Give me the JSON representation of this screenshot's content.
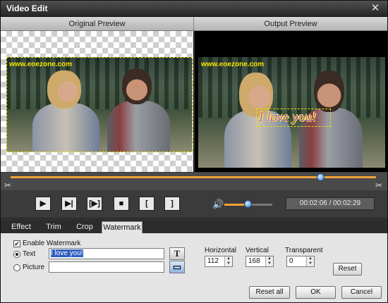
{
  "window": {
    "title": "Video Edit",
    "close_label": "✕"
  },
  "preview": {
    "original_label": "Original Preview",
    "output_label": "Output Preview",
    "site_text": "www.eoezone.com",
    "watermark_text": "I love you!"
  },
  "playback": {
    "time_display": "00:02:06 / 00:02:29",
    "position_fraction": 0.85,
    "volume_fraction": 0.5,
    "buttons": {
      "play": "▶",
      "step": "▶|",
      "frame": "[▶]",
      "stop": "■",
      "mark_in": "[",
      "mark_out": "]"
    }
  },
  "tabs": [
    {
      "label": "Effect"
    },
    {
      "label": "Trim"
    },
    {
      "label": "Crop"
    },
    {
      "label": "Watermark",
      "active": true
    }
  ],
  "watermark": {
    "enable_label": "Enable Watermark",
    "enabled": true,
    "text_label": "Text",
    "text_value": "I love you!",
    "picture_label": "Picture",
    "picture_value": "",
    "text_mode_selected": true,
    "font_button": "T",
    "horizontal_label": "Horizontal",
    "horizontal_value": "112",
    "vertical_label": "Vertical",
    "vertical_value": "168",
    "transparent_label": "Transparent",
    "transparent_value": "0",
    "reset_label": "Reset"
  },
  "footer": {
    "reset_all_label": "Reset all",
    "ok_label": "OK",
    "cancel_label": "Cancel"
  },
  "colors": {
    "accent": "#f0a23a",
    "thumb": "#3d86d6",
    "site_text": "#f6e700",
    "watermark_text": "#c84be0"
  }
}
